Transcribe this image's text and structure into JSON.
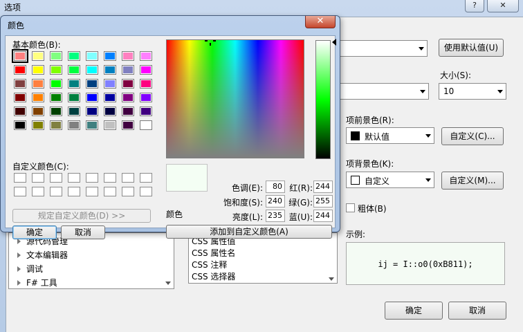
{
  "options_window": {
    "title": "选项",
    "help_label": "?",
    "close_label": "✕",
    "use_default_button": "使用默认值(U)",
    "size_label": "大小(S):",
    "size_value": "10",
    "item_foreground_label": "项前景色(R):",
    "item_foreground_value": "默认值",
    "item_foreground_color": "#000000",
    "custom_fg_button": "自定义(C)...",
    "item_background_label": "项背景色(K):",
    "item_background_value": "自定义",
    "item_background_color": "#ffffff",
    "custom_bg_button": "自定义(M)...",
    "bold_label": "粗体(B)",
    "sample_label": "示例:",
    "sample_text": "ij = I::o0(0xB811);",
    "ok_button": "确定",
    "cancel_button": "取消",
    "tree_items": [
      "源代码管理",
      "文本编辑器",
      "调试",
      "F# 工具"
    ],
    "display_items": [
      "CSS 属性值",
      "CSS 属性名",
      "CSS 注释",
      "CSS 选择器"
    ]
  },
  "color_dialog": {
    "title": "颜色",
    "close_label": "✕",
    "basic_colors_label": "基本颜色(B):",
    "basic_colors": [
      [
        "#ff8080",
        "#ffff80",
        "#80ff80",
        "#00ff80",
        "#80ffff",
        "#0080ff",
        "#ff80c0",
        "#ff80ff"
      ],
      [
        "#ff0000",
        "#ffff00",
        "#80ff00",
        "#00ff40",
        "#00ffff",
        "#0080c0",
        "#8080c0",
        "#ff00ff"
      ],
      [
        "#804040",
        "#ff8040",
        "#00ff00",
        "#008080",
        "#004080",
        "#8080ff",
        "#800040",
        "#ff0080"
      ],
      [
        "#800000",
        "#ff8000",
        "#008000",
        "#008040",
        "#0000ff",
        "#0000a0",
        "#800080",
        "#8000ff"
      ],
      [
        "#400000",
        "#804000",
        "#004000",
        "#004040",
        "#000080",
        "#000040",
        "#400040",
        "#400080"
      ],
      [
        "#000000",
        "#808000",
        "#808040",
        "#808080",
        "#408080",
        "#c0c0c0",
        "#400040",
        "#ffffff"
      ]
    ],
    "custom_colors_label": "自定义颜色(C):",
    "define_custom_button": "规定自定义颜色(D) >>",
    "ok_button": "确定",
    "cancel_button": "取消",
    "preview_label": "颜色",
    "preview_color": "#f4fef4",
    "hue_label": "色调(E):",
    "hue_value": "80",
    "sat_label": "饱和度(S):",
    "sat_value": "240",
    "lum_label": "亮度(L):",
    "lum_value": "235",
    "red_label": "红(R):",
    "red_value": "244",
    "green_label": "绿(G):",
    "green_value": "255",
    "blue_label": "蓝(U):",
    "blue_value": "244",
    "add_custom_button": "添加到自定义颜色(A)"
  }
}
